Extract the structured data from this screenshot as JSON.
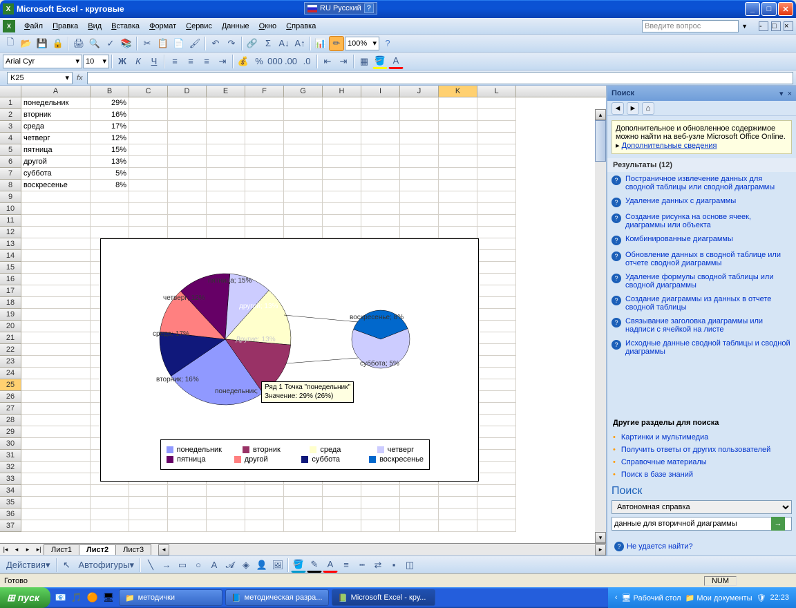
{
  "title": "Microsoft Excel - круговые",
  "lang": "RU Русский",
  "menu": [
    "Файл",
    "Правка",
    "Вид",
    "Вставка",
    "Формат",
    "Сервис",
    "Данные",
    "Окно",
    "Справка"
  ],
  "questionPlaceholder": "Введите вопрос",
  "font": {
    "name": "Arial Cyr",
    "size": "10"
  },
  "zoom": "100%",
  "namebox": "K25",
  "columns": [
    "A",
    "B",
    "C",
    "D",
    "E",
    "F",
    "G",
    "H",
    "I",
    "J",
    "K",
    "L"
  ],
  "rows": 37,
  "activeCol": "K",
  "activeRow": 25,
  "cells": [
    {
      "row": 1,
      "a": "понедельник",
      "b": "29%"
    },
    {
      "row": 2,
      "a": "вторник",
      "b": "16%"
    },
    {
      "row": 3,
      "a": "среда",
      "b": "17%"
    },
    {
      "row": 4,
      "a": "четверг",
      "b": "12%"
    },
    {
      "row": 5,
      "a": "пятница",
      "b": "15%"
    },
    {
      "row": 6,
      "a": "другой",
      "b": "13%"
    },
    {
      "row": 7,
      "a": "суббота",
      "b": "5%"
    },
    {
      "row": 8,
      "a": "воскресенье",
      "b": "8%"
    }
  ],
  "sheets": [
    "Лист1",
    "Лист2",
    "Лист3"
  ],
  "activeSheet": 1,
  "drawing": {
    "actions": "Действия",
    "autoshapes": "Автофигуры"
  },
  "status": "Готово",
  "statusNum": "NUM",
  "taskpane": {
    "title": "Поиск",
    "hint": "Дополнительное и обновленное содержимое можно найти на веб-узле Microsoft Office Online.",
    "hintLink": "Дополнительные сведения",
    "resultsLabel": "Результаты (12)",
    "results": [
      "Постраничное извлечение данных для сводной таблицы или сводной диаграммы",
      "Удаление данных с диаграммы",
      "Создание рисунка на основе ячеек, диаграммы или объекта",
      "Комбинированные диаграммы",
      "Обновление данных в сводной таблице или отчете сводной диаграммы",
      "Удаление формулы сводной таблицы или сводной диаграммы",
      "Создание диаграммы из данных в отчете сводной таблицы",
      "Связывание заголовка диаграммы или надписи с ячейкой на листе",
      "Исходные данные сводной таблицы и сводной диаграммы"
    ],
    "otherLabel": "Другие разделы для поиска",
    "other": [
      "Картинки и мультимедиа",
      "Получить ответы от других пользователей",
      "Справочные материалы",
      "Поиск в базе знаний"
    ],
    "searchLabel": "Поиск",
    "scope": "Автономная справка",
    "query": "данные для вторичной диаграммы",
    "cantFind": "Не удается найти?"
  },
  "chart_data": {
    "type": "pie",
    "title": "",
    "series": [
      {
        "name": "Ряд 1",
        "categories": [
          "понедельник",
          "вторник",
          "среда",
          "четверг",
          "пятница",
          "другой",
          "суббота",
          "воскресенье"
        ],
        "values": [
          29,
          16,
          17,
          12,
          15,
          13,
          5,
          8
        ],
        "colors": [
          "#9099ff",
          "#993266",
          "#ffffcc",
          "#ccccff",
          "#660066",
          "#ff8080",
          "#10187b",
          "#0168cc"
        ]
      }
    ],
    "secondary_pie": {
      "categories": [
        "суббота",
        "воскресенье"
      ],
      "values": [
        5,
        8
      ],
      "colors": [
        "#0168cc",
        "#ccccff"
      ]
    },
    "data_labels": [
      "понедельник;",
      "вторник; 16%",
      "среда; 17%",
      "четверг; 12%",
      "пятница; 15%",
      "другой; 13%",
      "Другие; 13%",
      "суббота; 5%",
      "воскресенье; 8%"
    ],
    "tooltip": "Ряд 1 Точка \"понедельник\"\nЗначение: 29% (26%)"
  },
  "taskbar": {
    "start": "пуск",
    "items": [
      "методички",
      "методическая разра...",
      "Microsoft Excel - кру..."
    ],
    "desktop": "Рабочий стол",
    "docs": "Мои документы",
    "time": "22:23"
  }
}
